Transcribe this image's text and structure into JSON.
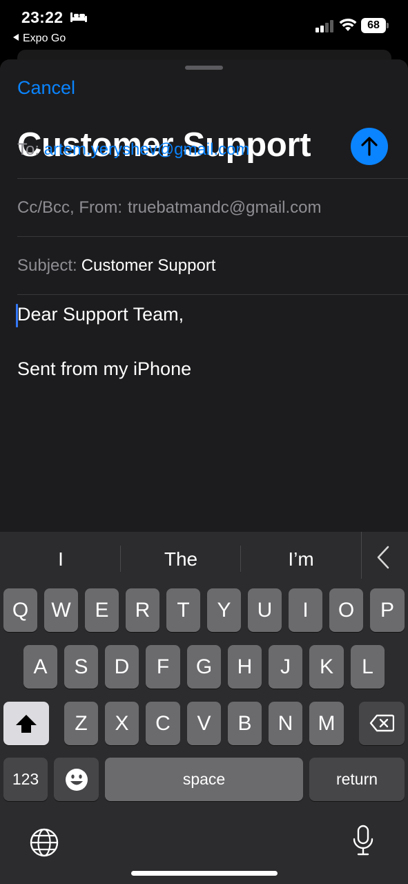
{
  "status_bar": {
    "time": "23:22",
    "back_app": "Expo Go",
    "battery": "68"
  },
  "compose": {
    "cancel_label": "Cancel",
    "title": "Customer Support",
    "to_label": "To:",
    "to_value": "artem.yeryshev@gmail.com",
    "cc_label": "Cc/Bcc, From:",
    "cc_value": "truebatmandc@gmail.com",
    "subject_label": "Subject:",
    "subject_value": "Customer Support",
    "body_line1": "Dear Support Team,",
    "body_line2": "Sent from my iPhone"
  },
  "colors": {
    "accent": "#0a84ff",
    "sheet_bg": "#1c1c1e",
    "keyboard_bg": "#2c2c2e"
  },
  "keyboard": {
    "suggestions": [
      "I",
      "The",
      "I’m"
    ],
    "row1": [
      "Q",
      "W",
      "E",
      "R",
      "T",
      "Y",
      "U",
      "I",
      "O",
      "P"
    ],
    "row2": [
      "A",
      "S",
      "D",
      "F",
      "G",
      "H",
      "J",
      "K",
      "L"
    ],
    "row3": [
      "Z",
      "X",
      "C",
      "V",
      "B",
      "N",
      "M"
    ],
    "numbers_label": "123",
    "space_label": "space",
    "return_label": "return",
    "icons": [
      "shift-icon",
      "backspace-icon",
      "emoji-icon",
      "globe-icon",
      "mic-icon",
      "collapse-icon"
    ]
  }
}
